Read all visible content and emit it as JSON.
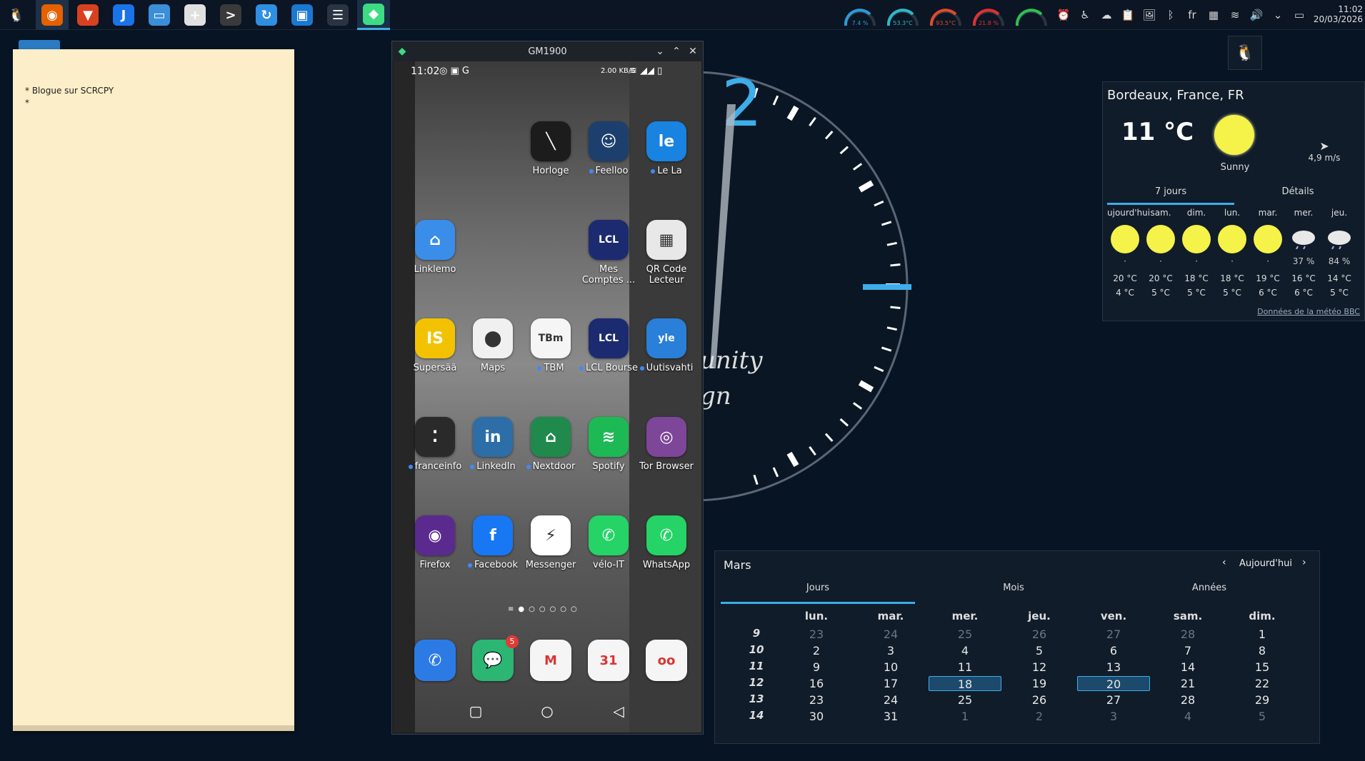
{
  "taskbar": {
    "apps": [
      {
        "name": "tux-icon",
        "glyph": "🐧",
        "color": "#0b1524"
      },
      {
        "name": "firefox-icon",
        "glyph": "◉",
        "color": "#e66000"
      },
      {
        "name": "brave-icon",
        "glyph": "▼",
        "color": "#d8411f"
      },
      {
        "name": "jdownloader-icon",
        "glyph": "J",
        "color": "#1a73e8"
      },
      {
        "name": "file-manager-icon",
        "glyph": "▭",
        "color": "#3a8fd8"
      },
      {
        "name": "new-document-icon",
        "glyph": "+",
        "color": "#e0e0e0"
      },
      {
        "name": "terminal-icon",
        "glyph": ">",
        "color": "#3a3a3a"
      },
      {
        "name": "sync-icon",
        "glyph": "↻",
        "color": "#2f8fe0"
      },
      {
        "name": "store-icon",
        "glyph": "▣",
        "color": "#1a78d0"
      },
      {
        "name": "settings-sliders-icon",
        "glyph": "☰",
        "color": "#2a3442"
      },
      {
        "name": "android-icon",
        "glyph": "◆",
        "color": "#3ddc84"
      }
    ],
    "gauges": [
      {
        "label": "7.4 %",
        "color": "#2e9ad8"
      },
      {
        "label": "53.3°C",
        "color": "#2eb8c8"
      },
      {
        "label": "93.5°C",
        "color": "#e04a2a"
      },
      {
        "label": "21.8 %",
        "color": "#e03030"
      },
      {
        "label": "",
        "color": "#2ec050"
      }
    ],
    "tray": [
      "alarm-icon",
      "accessibility-icon",
      "weather-icon",
      "clipboard-icon",
      "image-icon",
      "bluetooth-icon",
      "language",
      "storage-icon",
      "wifi-icon",
      "volume-icon",
      "chevron-down-icon",
      "desktop-icon"
    ],
    "tray_glyphs": [
      "⏰",
      "♿",
      "☁",
      "📋",
      "🖼",
      "ᛒ",
      "fr",
      "▦",
      "≋",
      "🔊",
      "⌄",
      "▭"
    ],
    "clock_time": "11:02",
    "clock_date": "20/03/2026"
  },
  "note": {
    "text": "* Blogue sur SCRCPY\n*"
  },
  "phone_window": {
    "title": "GM1900",
    "status_time": "11:02",
    "status_right": "2.00 KB/S",
    "apps": [
      {
        "label": "Horloge",
        "color": "#1c1c1c",
        "glyph": "╲",
        "dot": false
      },
      {
        "label": "Feelloo",
        "color": "#1c3f6e",
        "glyph": "☺",
        "dot": true
      },
      {
        "label": "Le La",
        "color": "#1883e0",
        "glyph": "le",
        "dot": true
      },
      {
        "label": "Linklemo",
        "color": "#3a8de8",
        "glyph": "⌂",
        "dot": false
      },
      {
        "label": "Mes Comptes ...",
        "color": "#1c2b70",
        "glyph": "LCL",
        "dot": false
      },
      {
        "label": "QR Code Lecteur",
        "color": "#e8e8e8",
        "glyph": "▦",
        "dot": false
      },
      {
        "label": "Supersää",
        "color": "#f2c200",
        "glyph": "IS",
        "dot": false
      },
      {
        "label": "Maps",
        "color": "#f0f0f0",
        "glyph": "⬤",
        "dot": false
      },
      {
        "label": "TBM",
        "color": "#f5f5f5",
        "glyph": "TBm",
        "dot": true
      },
      {
        "label": "LCL Bourse",
        "color": "#1c2b70",
        "glyph": "LCL",
        "dot": true
      },
      {
        "label": "Uutisvahti",
        "color": "#2a7fd8",
        "glyph": "yle",
        "dot": true
      },
      {
        "label": "franceinfo",
        "color": "#2a2a2a",
        "glyph": "⁚",
        "dot": true
      },
      {
        "label": "LinkedIn",
        "color": "#2d6ea8",
        "glyph": "in",
        "dot": true
      },
      {
        "label": "Nextdoor",
        "color": "#1f8a4c",
        "glyph": "⌂",
        "dot": true
      },
      {
        "label": "Spotify",
        "color": "#1db954",
        "glyph": "≋",
        "dot": false
      },
      {
        "label": "Tor Browser",
        "color": "#7d4698",
        "glyph": "◎",
        "dot": false
      },
      {
        "label": "Firefox",
        "color": "#5b2a8e",
        "glyph": "◉",
        "dot": false
      },
      {
        "label": "Facebook",
        "color": "#1877f2",
        "glyph": "f",
        "dot": true
      },
      {
        "label": "Messenger",
        "color": "#ffffff",
        "glyph": "⚡",
        "dot": false
      },
      {
        "label": "vélo-IT",
        "color": "#25d366",
        "glyph": "✆",
        "dot": false
      },
      {
        "label": "WhatsApp",
        "color": "#25d366",
        "glyph": "✆",
        "dot": false
      }
    ],
    "dock": [
      {
        "name": "phone-icon",
        "color": "#2c7be5",
        "glyph": "✆"
      },
      {
        "name": "messages-icon",
        "color": "#2bb673",
        "glyph": "💬",
        "badge": "5"
      },
      {
        "name": "gmail-icon",
        "color": "#f5f5f5",
        "glyph": "M"
      },
      {
        "name": "calendar-icon",
        "color": "#f5f5f5",
        "glyph": "31"
      },
      {
        "name": "voicemail-icon",
        "color": "#f5f5f5",
        "glyph": "oo"
      }
    ]
  },
  "clock_widget": {
    "text_fragment_1": "unity",
    "text_fragment_2": "gn",
    "numeral": "2"
  },
  "weather": {
    "city": "Bordeaux, France, FR",
    "temperature": "11 °C",
    "condition": "Sunny",
    "wind": "4,9 m/s",
    "tabs": [
      "7 jours",
      "Détails"
    ],
    "days": [
      {
        "name": "ujourd'hui",
        "icon": "sun",
        "precip": "·",
        "hi": "20 °C",
        "lo": "4 °C"
      },
      {
        "name": "sam.",
        "icon": "sun",
        "precip": "·",
        "hi": "20 °C",
        "lo": "5 °C"
      },
      {
        "name": "dim.",
        "icon": "sun",
        "precip": "·",
        "hi": "18 °C",
        "lo": "5 °C"
      },
      {
        "name": "lun.",
        "icon": "sun",
        "precip": "·",
        "hi": "18 °C",
        "lo": "5 °C"
      },
      {
        "name": "mar.",
        "icon": "sun",
        "precip": "·",
        "hi": "19 °C",
        "lo": "6 °C"
      },
      {
        "name": "mer.",
        "icon": "rain",
        "precip": "37 %",
        "hi": "16 °C",
        "lo": "6 °C"
      },
      {
        "name": "jeu.",
        "icon": "rain",
        "precip": "84 %",
        "hi": "14 °C",
        "lo": "5 °C"
      }
    ],
    "credit": "Données de la météo BBC"
  },
  "calendar": {
    "month": "Mars",
    "today_button": "Aujourd'hui",
    "tabs": [
      "Jours",
      "Mois",
      "Années"
    ],
    "headers": [
      "lun.",
      "mar.",
      "mer.",
      "jeu.",
      "ven.",
      "sam.",
      "dim."
    ],
    "weeks": [
      {
        "wk": "9",
        "days": [
          "23",
          "24",
          "25",
          "26",
          "27",
          "28",
          "1"
        ]
      },
      {
        "wk": "10",
        "days": [
          "2",
          "3",
          "4",
          "5",
          "6",
          "7",
          "8"
        ]
      },
      {
        "wk": "11",
        "days": [
          "9",
          "10",
          "11",
          "12",
          "13",
          "14",
          "15"
        ]
      },
      {
        "wk": "12",
        "days": [
          "16",
          "17",
          "18",
          "19",
          "20",
          "21",
          "22"
        ]
      },
      {
        "wk": "13",
        "days": [
          "23",
          "24",
          "25",
          "26",
          "27",
          "28",
          "29"
        ]
      },
      {
        "wk": "14",
        "days": [
          "30",
          "31",
          "1",
          "2",
          "3",
          "4",
          "5"
        ]
      }
    ],
    "dim_cells": [
      [
        0,
        0
      ],
      [
        0,
        1
      ],
      [
        0,
        2
      ],
      [
        0,
        3
      ],
      [
        0,
        4
      ],
      [
        0,
        5
      ],
      [
        5,
        2
      ],
      [
        5,
        3
      ],
      [
        5,
        4
      ],
      [
        5,
        5
      ],
      [
        5,
        6
      ]
    ],
    "highlight_cells": [
      [
        3,
        2
      ],
      [
        3,
        4
      ]
    ]
  }
}
